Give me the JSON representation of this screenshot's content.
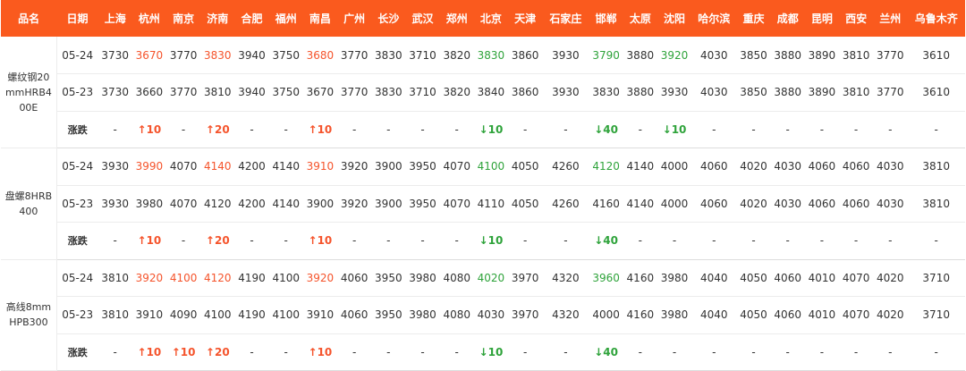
{
  "table": {
    "headers": [
      "品名",
      "日期",
      "上海",
      "杭州",
      "南京",
      "济南",
      "合肥",
      "福州",
      "南昌",
      "广州",
      "长沙",
      "武汉",
      "郑州",
      "北京",
      "天津",
      "石家庄",
      "邯郸",
      "太原",
      "沈阳",
      "哈尔滨",
      "重庆",
      "成都",
      "昆明",
      "西安",
      "兰州",
      "乌鲁木齐"
    ],
    "groups": [
      {
        "product": "螺纹钢20mmHRB400E",
        "rows": [
          {
            "label": "05-24",
            "type": "date",
            "cells": [
              {
                "v": "3730"
              },
              {
                "v": "3670",
                "c": "up"
              },
              {
                "v": "3770"
              },
              {
                "v": "3830",
                "c": "up"
              },
              {
                "v": "3940"
              },
              {
                "v": "3750"
              },
              {
                "v": "3680",
                "c": "up"
              },
              {
                "v": "3770"
              },
              {
                "v": "3830"
              },
              {
                "v": "3710"
              },
              {
                "v": "3820"
              },
              {
                "v": "3830",
                "c": "down"
              },
              {
                "v": "3860"
              },
              {
                "v": "3930"
              },
              {
                "v": "3790",
                "c": "down"
              },
              {
                "v": "3880"
              },
              {
                "v": "3920",
                "c": "down"
              },
              {
                "v": "4030"
              },
              {
                "v": "3850"
              },
              {
                "v": "3880"
              },
              {
                "v": "3890"
              },
              {
                "v": "3810"
              },
              {
                "v": "3770"
              },
              {
                "v": "3610"
              }
            ]
          },
          {
            "label": "05-23",
            "type": "date",
            "cells": [
              {
                "v": "3730"
              },
              {
                "v": "3660"
              },
              {
                "v": "3770"
              },
              {
                "v": "3810"
              },
              {
                "v": "3940"
              },
              {
                "v": "3750"
              },
              {
                "v": "3670"
              },
              {
                "v": "3770"
              },
              {
                "v": "3830"
              },
              {
                "v": "3710"
              },
              {
                "v": "3820"
              },
              {
                "v": "3840"
              },
              {
                "v": "3860"
              },
              {
                "v": "3930"
              },
              {
                "v": "3830"
              },
              {
                "v": "3880"
              },
              {
                "v": "3930"
              },
              {
                "v": "4030"
              },
              {
                "v": "3850"
              },
              {
                "v": "3880"
              },
              {
                "v": "3890"
              },
              {
                "v": "3810"
              },
              {
                "v": "3770"
              },
              {
                "v": "3610"
              }
            ]
          },
          {
            "label": "涨跌",
            "type": "change",
            "cells": [
              {
                "v": "-"
              },
              {
                "v": "↑10",
                "c": "up"
              },
              {
                "v": "-"
              },
              {
                "v": "↑20",
                "c": "up"
              },
              {
                "v": "-"
              },
              {
                "v": "-"
              },
              {
                "v": "↑10",
                "c": "up"
              },
              {
                "v": "-"
              },
              {
                "v": "-"
              },
              {
                "v": "-"
              },
              {
                "v": "-"
              },
              {
                "v": "↓10",
                "c": "down"
              },
              {
                "v": "-"
              },
              {
                "v": "-"
              },
              {
                "v": "↓40",
                "c": "down"
              },
              {
                "v": "-"
              },
              {
                "v": "↓10",
                "c": "down"
              },
              {
                "v": "-"
              },
              {
                "v": "-"
              },
              {
                "v": "-"
              },
              {
                "v": "-"
              },
              {
                "v": "-"
              },
              {
                "v": "-"
              },
              {
                "v": "-"
              }
            ]
          }
        ]
      },
      {
        "product": "盘螺8HRB400",
        "rows": [
          {
            "label": "05-24",
            "type": "date",
            "cells": [
              {
                "v": "3930"
              },
              {
                "v": "3990",
                "c": "up"
              },
              {
                "v": "4070"
              },
              {
                "v": "4140",
                "c": "up"
              },
              {
                "v": "4200"
              },
              {
                "v": "4140"
              },
              {
                "v": "3910",
                "c": "up"
              },
              {
                "v": "3920"
              },
              {
                "v": "3900"
              },
              {
                "v": "3950"
              },
              {
                "v": "4070"
              },
              {
                "v": "4100",
                "c": "down"
              },
              {
                "v": "4050"
              },
              {
                "v": "4260"
              },
              {
                "v": "4120",
                "c": "down"
              },
              {
                "v": "4140"
              },
              {
                "v": "4000"
              },
              {
                "v": "4060"
              },
              {
                "v": "4020"
              },
              {
                "v": "4030"
              },
              {
                "v": "4060"
              },
              {
                "v": "4060"
              },
              {
                "v": "4030"
              },
              {
                "v": "3810"
              }
            ]
          },
          {
            "label": "05-23",
            "type": "date",
            "cells": [
              {
                "v": "3930"
              },
              {
                "v": "3980"
              },
              {
                "v": "4070"
              },
              {
                "v": "4120"
              },
              {
                "v": "4200"
              },
              {
                "v": "4140"
              },
              {
                "v": "3900"
              },
              {
                "v": "3920"
              },
              {
                "v": "3900"
              },
              {
                "v": "3950"
              },
              {
                "v": "4070"
              },
              {
                "v": "4110"
              },
              {
                "v": "4050"
              },
              {
                "v": "4260"
              },
              {
                "v": "4160"
              },
              {
                "v": "4140"
              },
              {
                "v": "4000"
              },
              {
                "v": "4060"
              },
              {
                "v": "4020"
              },
              {
                "v": "4030"
              },
              {
                "v": "4060"
              },
              {
                "v": "4060"
              },
              {
                "v": "4030"
              },
              {
                "v": "3810"
              }
            ]
          },
          {
            "label": "涨跌",
            "type": "change",
            "cells": [
              {
                "v": "-"
              },
              {
                "v": "↑10",
                "c": "up"
              },
              {
                "v": "-"
              },
              {
                "v": "↑20",
                "c": "up"
              },
              {
                "v": "-"
              },
              {
                "v": "-"
              },
              {
                "v": "↑10",
                "c": "up"
              },
              {
                "v": "-"
              },
              {
                "v": "-"
              },
              {
                "v": "-"
              },
              {
                "v": "-"
              },
              {
                "v": "↓10",
                "c": "down"
              },
              {
                "v": "-"
              },
              {
                "v": "-"
              },
              {
                "v": "↓40",
                "c": "down"
              },
              {
                "v": "-"
              },
              {
                "v": "-"
              },
              {
                "v": "-"
              },
              {
                "v": "-"
              },
              {
                "v": "-"
              },
              {
                "v": "-"
              },
              {
                "v": "-"
              },
              {
                "v": "-"
              },
              {
                "v": "-"
              }
            ]
          }
        ]
      },
      {
        "product": "高线8mmHPB300",
        "rows": [
          {
            "label": "05-24",
            "type": "date",
            "cells": [
              {
                "v": "3810"
              },
              {
                "v": "3920",
                "c": "up"
              },
              {
                "v": "4100",
                "c": "up"
              },
              {
                "v": "4120",
                "c": "up"
              },
              {
                "v": "4190"
              },
              {
                "v": "4100"
              },
              {
                "v": "3920",
                "c": "up"
              },
              {
                "v": "4060"
              },
              {
                "v": "3950"
              },
              {
                "v": "3980"
              },
              {
                "v": "4080"
              },
              {
                "v": "4020",
                "c": "down"
              },
              {
                "v": "3970"
              },
              {
                "v": "4320"
              },
              {
                "v": "3960",
                "c": "down"
              },
              {
                "v": "4160"
              },
              {
                "v": "3980"
              },
              {
                "v": "4040"
              },
              {
                "v": "4050"
              },
              {
                "v": "4060"
              },
              {
                "v": "4010"
              },
              {
                "v": "4070"
              },
              {
                "v": "4020"
              },
              {
                "v": "3710"
              }
            ]
          },
          {
            "label": "05-23",
            "type": "date",
            "cells": [
              {
                "v": "3810"
              },
              {
                "v": "3910"
              },
              {
                "v": "4090"
              },
              {
                "v": "4100"
              },
              {
                "v": "4190"
              },
              {
                "v": "4100"
              },
              {
                "v": "3910"
              },
              {
                "v": "4060"
              },
              {
                "v": "3950"
              },
              {
                "v": "3980"
              },
              {
                "v": "4080"
              },
              {
                "v": "4030"
              },
              {
                "v": "3970"
              },
              {
                "v": "4320"
              },
              {
                "v": "4000"
              },
              {
                "v": "4160"
              },
              {
                "v": "3980"
              },
              {
                "v": "4040"
              },
              {
                "v": "4050"
              },
              {
                "v": "4060"
              },
              {
                "v": "4010"
              },
              {
                "v": "4070"
              },
              {
                "v": "4020"
              },
              {
                "v": "3710"
              }
            ]
          },
          {
            "label": "涨跌",
            "type": "change",
            "cells": [
              {
                "v": "-"
              },
              {
                "v": "↑10",
                "c": "up"
              },
              {
                "v": "↑10",
                "c": "up"
              },
              {
                "v": "↑20",
                "c": "up"
              },
              {
                "v": "-"
              },
              {
                "v": "-"
              },
              {
                "v": "↑10",
                "c": "up"
              },
              {
                "v": "-"
              },
              {
                "v": "-"
              },
              {
                "v": "-"
              },
              {
                "v": "-"
              },
              {
                "v": "↓10",
                "c": "down"
              },
              {
                "v": "-"
              },
              {
                "v": "-"
              },
              {
                "v": "↓40",
                "c": "down"
              },
              {
                "v": "-"
              },
              {
                "v": "-"
              },
              {
                "v": "-"
              },
              {
                "v": "-"
              },
              {
                "v": "-"
              },
              {
                "v": "-"
              },
              {
                "v": "-"
              },
              {
                "v": "-"
              },
              {
                "v": "-"
              }
            ]
          }
        ]
      }
    ]
  },
  "colors": {
    "header_bg": "#fa5a1e",
    "up": "#f5542c",
    "down": "#2fa33b"
  }
}
